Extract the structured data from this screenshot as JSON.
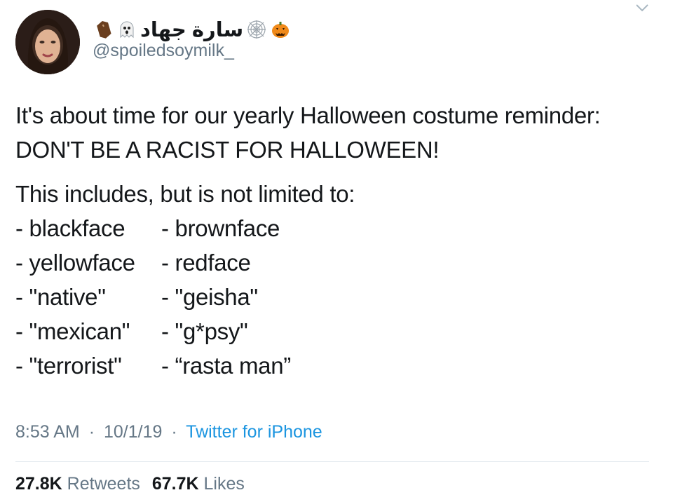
{
  "user": {
    "display_name": "سارة جهاد",
    "handle": "@spoiledsoymilk_",
    "name_icons": [
      "pumpkin-icon",
      "spiderweb-icon",
      "ghost-icon",
      "coffin-icon"
    ]
  },
  "tweet": {
    "lines": [
      "It's about time for our yearly Halloween costume reminder:",
      "DON'T BE A RACIST FOR HALLOWEEN!"
    ],
    "intro": "This includes, but is not limited to:",
    "list": [
      [
        "- blackface",
        "- brownface"
      ],
      [
        "- yellowface",
        "- redface"
      ],
      [
        "- \"native\"",
        "- \"geisha\""
      ],
      [
        "- \"mexican\"",
        "- \"g*psy\""
      ],
      [
        "- \"terrorist\"",
        "- “rasta man”"
      ]
    ]
  },
  "meta": {
    "time": "8:53 AM",
    "date": "10/1/19",
    "separator": "·",
    "source": "Twitter for iPhone"
  },
  "stats": {
    "retweets_count": "27.8K",
    "retweets_label": "Retweets",
    "likes_count": "67.7K",
    "likes_label": "Likes"
  },
  "colors": {
    "text": "#14171a",
    "secondary": "#657786",
    "link": "#1b95e0",
    "divider": "#e1e8ed"
  }
}
